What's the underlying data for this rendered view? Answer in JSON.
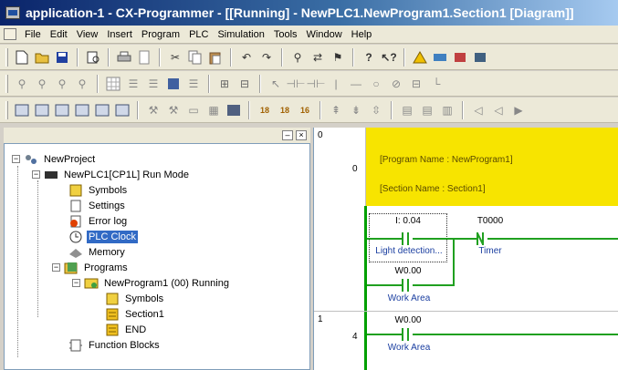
{
  "window": {
    "title": "application-1 - CX-Programmer - [[Running] - NewPLC1.NewProgram1.Section1 [Diagram]]"
  },
  "menu": {
    "items": [
      "File",
      "Edit",
      "View",
      "Insert",
      "Program",
      "PLC",
      "Simulation",
      "Tools",
      "Window",
      "Help"
    ]
  },
  "project_tree": {
    "items": [
      {
        "label": "NewProject",
        "icon": "project-icon"
      },
      {
        "label": "NewPLC1[CP1L] Run Mode",
        "icon": "plc-icon"
      },
      {
        "label": "Symbols",
        "icon": "symbols-icon"
      },
      {
        "label": "Settings",
        "icon": "settings-icon"
      },
      {
        "label": "Error log",
        "icon": "error-log-icon"
      },
      {
        "label": "PLC Clock",
        "icon": "clock-icon"
      },
      {
        "label": "Memory",
        "icon": "memory-icon"
      },
      {
        "label": "Programs",
        "icon": "programs-icon"
      },
      {
        "label": "NewProgram1 (00) Running",
        "icon": "program-icon"
      },
      {
        "label": "Symbols",
        "icon": "symbols-icon"
      },
      {
        "label": "Section1",
        "icon": "section-icon"
      },
      {
        "label": "END",
        "icon": "section-icon"
      },
      {
        "label": "Function Blocks",
        "icon": "function-blocks-icon"
      }
    ],
    "selected": "PLC Clock"
  },
  "diagram": {
    "rungs": [
      {
        "index": "0",
        "step": "0"
      },
      {
        "index": "1",
        "step": "4"
      }
    ],
    "header": {
      "program_name": "[Program Name : NewProgram1]",
      "section_name": "[Section Name : Section1]"
    },
    "contacts": [
      {
        "address": "I: 0.04",
        "comment": "Light detection..."
      },
      {
        "address": "T0000",
        "comment": "Timer"
      },
      {
        "address": "W0.00",
        "comment": "Work Area"
      },
      {
        "address": "W0.00",
        "comment": "Work Area"
      }
    ]
  },
  "colors": {
    "title_bar": "#0a246a",
    "header_block": "#f7e400",
    "power_rail": "#00a000",
    "comment_text": "#1a3ea0",
    "selection": "#316ac5"
  }
}
